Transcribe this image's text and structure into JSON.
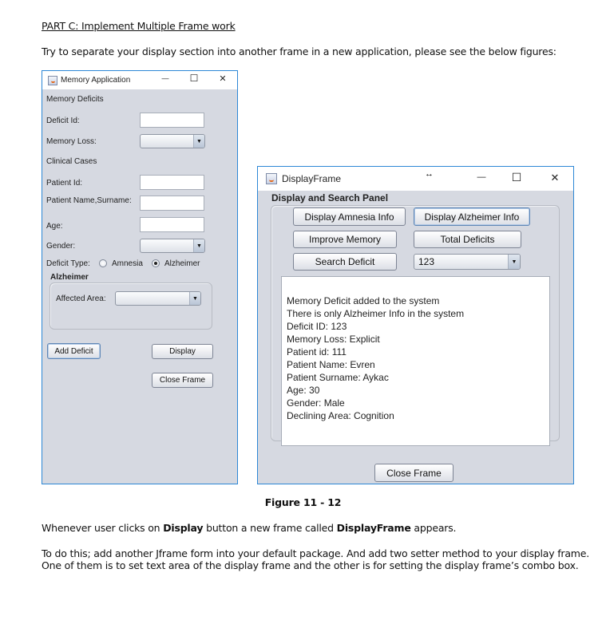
{
  "document": {
    "heading": "PART C: Implement Multiple Frame work",
    "intro": "Try to separate your display section into another frame in a new application, please see the below figures:",
    "caption": "Figure 11 - 12",
    "paragraph1": {
      "part1": "Whenever user clicks on ",
      "bold1": "Display",
      "part2": " button a new frame called ",
      "bold2": "DisplayFrame",
      "part3": " appears."
    },
    "paragraph2_line1": "To do this; add another Jframe form into your default package. And add two setter method to your display frame.",
    "paragraph2_line2": "One of them is to set text area of the display frame and the other is for setting the display frame’s combo box."
  },
  "memory_app": {
    "title": "Memory Application",
    "window_controls": {
      "minimize": "—",
      "maximize": "☐",
      "close": "✕"
    },
    "section_memory_deficits": "Memory Deficits",
    "deficit_id_label": "Deficit Id:",
    "deficit_id_value": "",
    "memory_loss_label": "Memory Loss:",
    "memory_loss_value": "",
    "section_clinical_cases": "Clinical Cases",
    "patient_id_label": "Patient Id:",
    "patient_id_value": "",
    "patient_name_label": "Patient Name,Surname:",
    "patient_name_value": "",
    "age_label": "Age:",
    "age_value": "",
    "gender_label": "Gender:",
    "gender_value": "",
    "deficit_type_label": "Deficit Type:",
    "deficit_type_options": [
      {
        "label": "Amnesia",
        "selected": false
      },
      {
        "label": "Alzheimer",
        "selected": true
      }
    ],
    "alzheimer_group_title": "Alzheimer",
    "affected_area_label": "Affected Area:",
    "affected_area_value": "",
    "add_deficit_button": "Add Deficit",
    "display_button": "Display",
    "close_frame_button": "Close Frame"
  },
  "display_frame": {
    "title": "DisplayFrame",
    "window_controls": {
      "minimize": "—",
      "maximize": "☐",
      "close": "✕"
    },
    "panel_title": "Display and Search Panel",
    "buttons": {
      "display_amnesia": "Display Amnesia Info",
      "display_alzheimer": "Display Alzheimer Info",
      "improve_memory": "Improve Memory",
      "total_deficits": "Total Deficits",
      "search_deficit": "Search Deficit",
      "close_frame": "Close Frame"
    },
    "search_combo_value": "123",
    "output_lines": [
      "Memory Deficit added to the system",
      "There is only Alzheimer Info in the system",
      "Deficit ID: 123",
      "Memory Loss: Explicit",
      "Patient id: 111",
      "Patient Name: Evren",
      "Patient Surname: Aykac",
      "Age: 30",
      "Gender: Male",
      "Declining Area: Cognition"
    ]
  },
  "colors": {
    "window_border": "#2d87d6",
    "window_background": "#d6d9e1"
  }
}
